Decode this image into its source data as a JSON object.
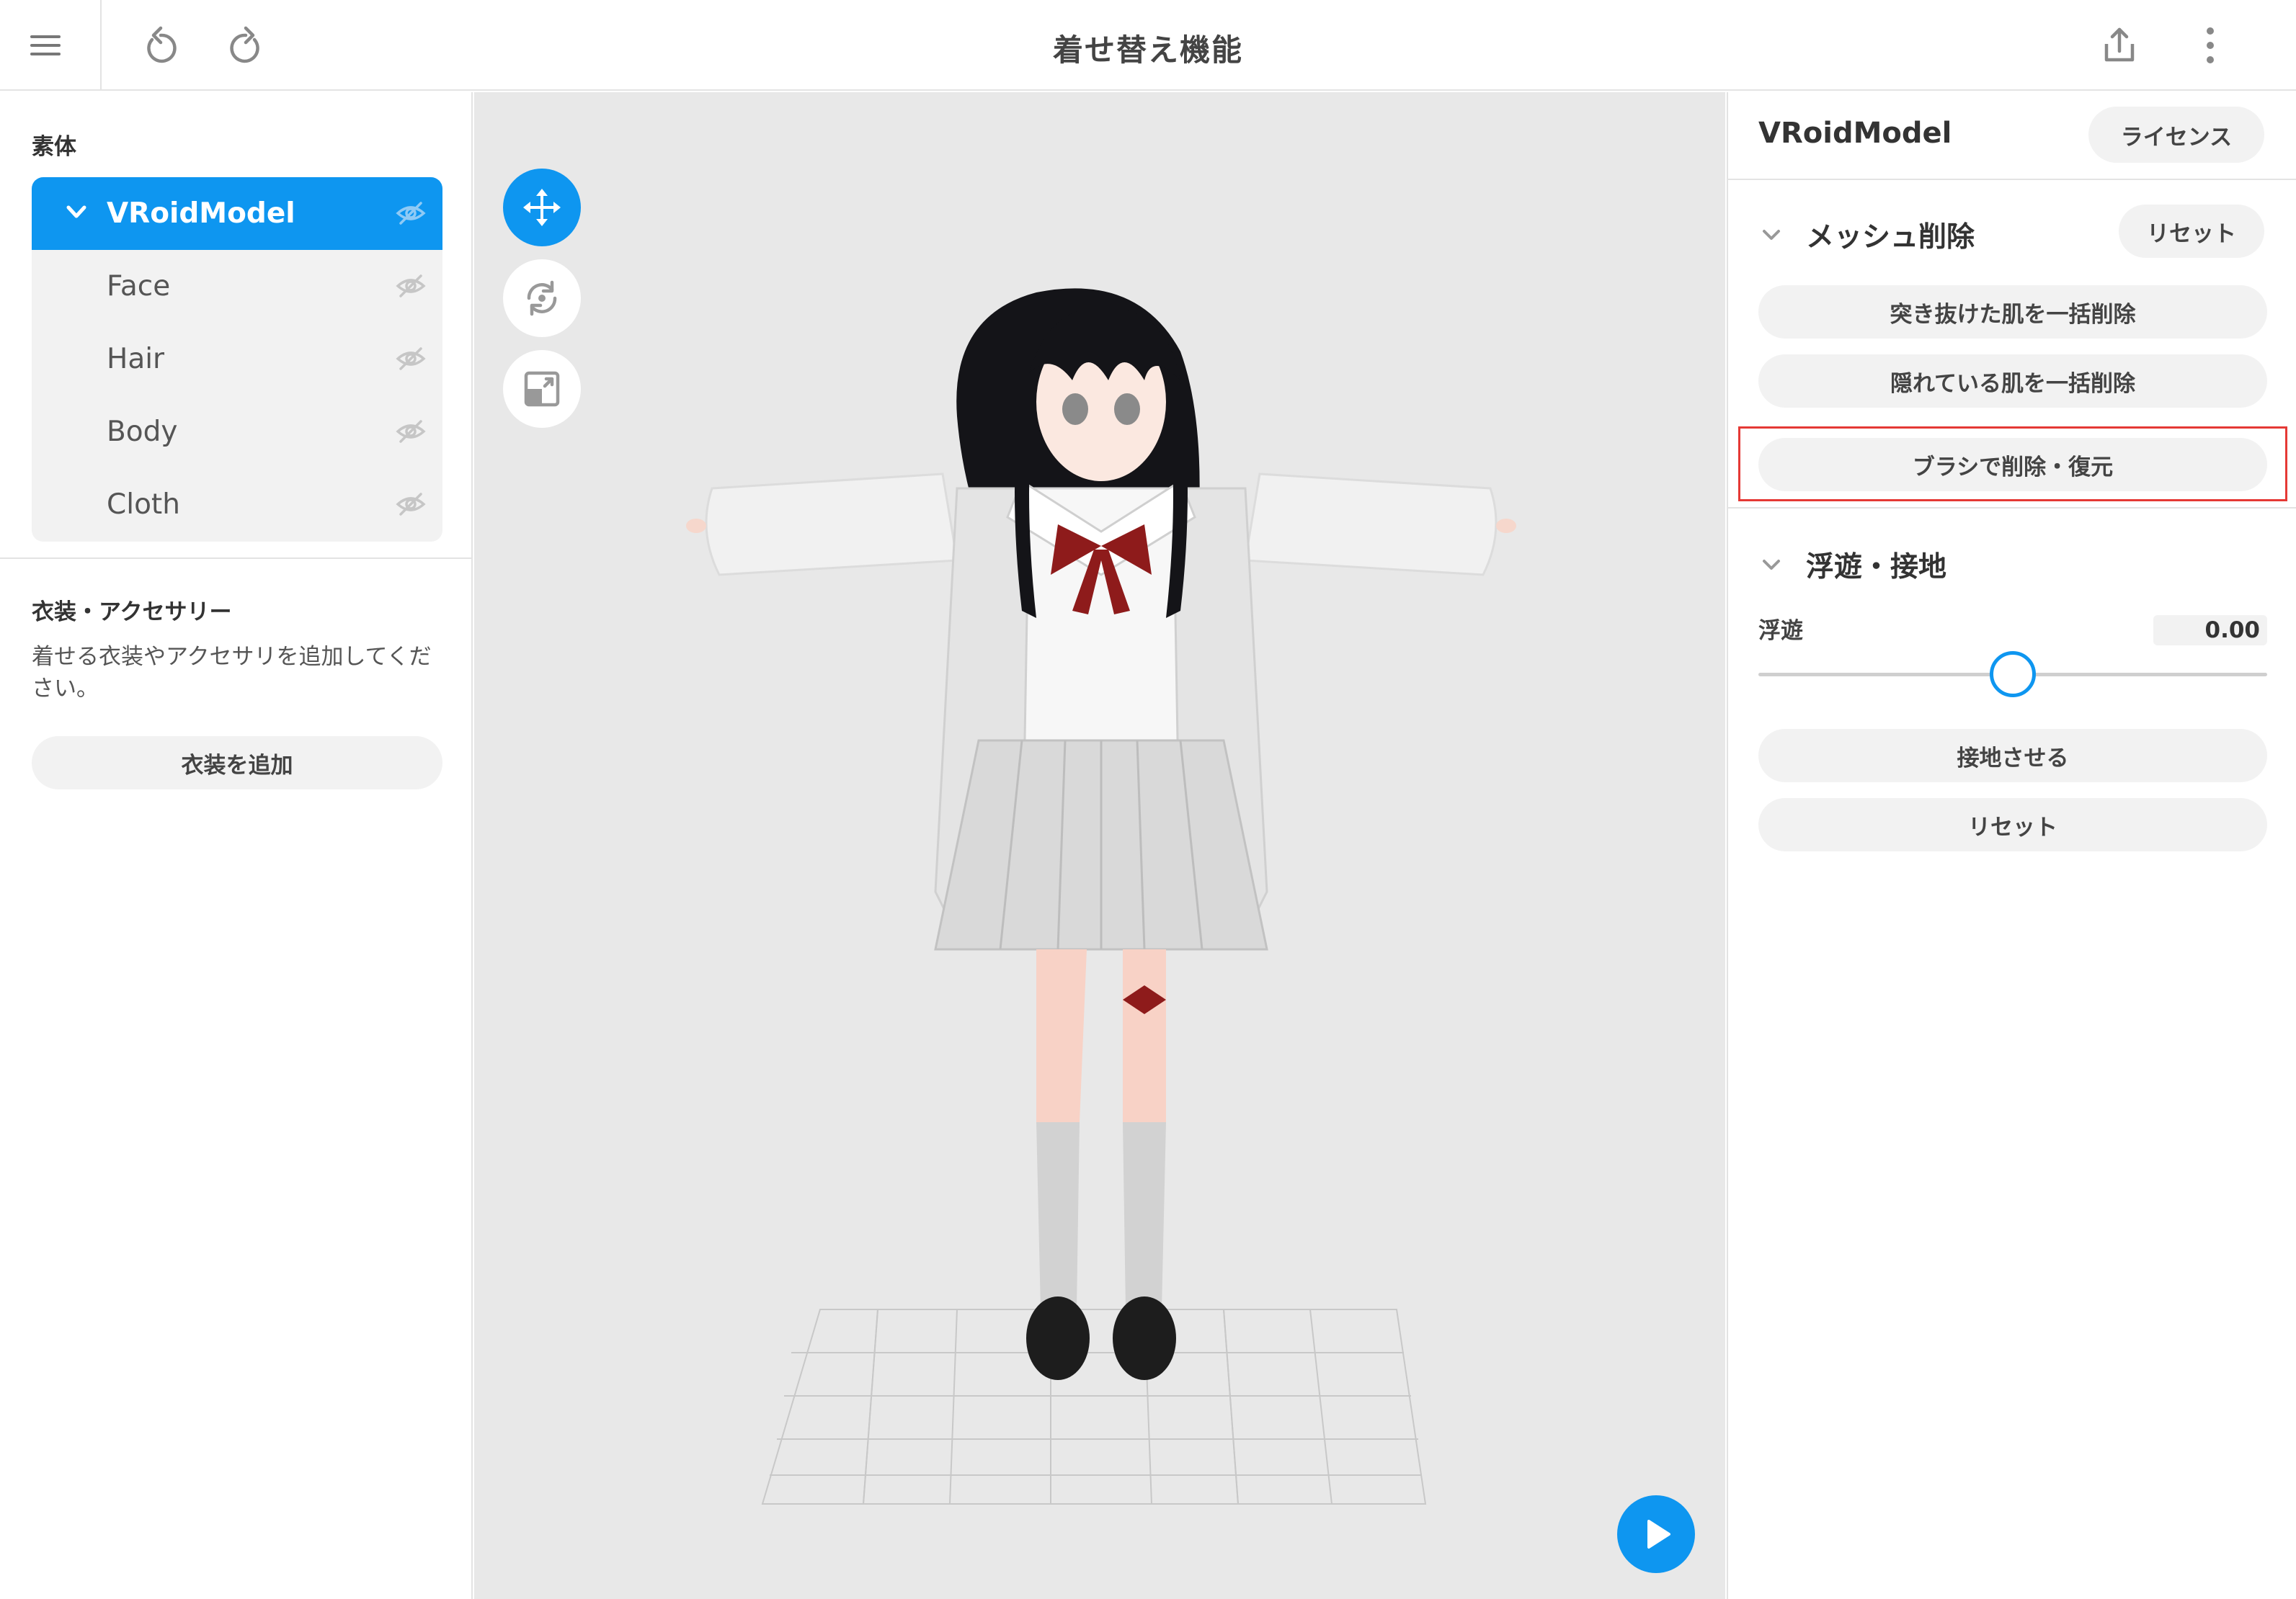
{
  "app": {
    "title": "着せ替え機能"
  },
  "left_panel": {
    "body_section_title": "素体",
    "tree": [
      {
        "label": "VRoidModel",
        "selected": true
      },
      {
        "label": "Face"
      },
      {
        "label": "Hair"
      },
      {
        "label": "Body"
      },
      {
        "label": "Cloth"
      }
    ],
    "outfit_section_title": "衣装・アクセサリー",
    "outfit_description": "着せる衣装やアクセサリを追加してください。",
    "add_outfit_button": "衣装を追加"
  },
  "right_panel": {
    "model_name": "VRoidModel",
    "license_button": "ライセンス",
    "mesh_section": {
      "title": "メッシュ削除",
      "reset_button": "リセット",
      "delete_protruding_button": "突き抜けた肌を一括削除",
      "delete_hidden_button": "隠れている肌を一括削除",
      "brush_button": "ブラシで削除・復元"
    },
    "float_section": {
      "title": "浮遊・接地",
      "float_label": "浮遊",
      "float_value": "0.00",
      "slider_fraction": 0.5,
      "ground_button": "接地させる",
      "reset_button": "リセット"
    }
  },
  "colors": {
    "accent": "#0e96f0",
    "highlight": "#e53935",
    "panel_bg": "#f2f2f2",
    "viewport_bg": "#e8e8e8"
  },
  "icons": [
    "menu-icon",
    "undo-icon",
    "redo-icon",
    "export-icon",
    "more-vert-icon",
    "chevron-down-icon",
    "eye-off-icon",
    "move-icon",
    "rotate-icon",
    "resize-icon",
    "play-icon"
  ]
}
